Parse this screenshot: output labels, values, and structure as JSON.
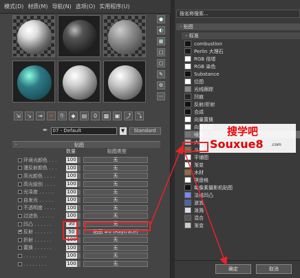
{
  "menu": [
    "模式(D)",
    "材质(M)",
    "导航(N)",
    "选项(O)",
    "实用程序(U)"
  ],
  "material_name": "07 - Default",
  "material_type": "Standard",
  "rollout_title": "贴图",
  "columns": {
    "amount": "数量",
    "map_type": "贴图类型"
  },
  "maps": [
    {
      "label": "环境光颜色 . . .",
      "amount": "100",
      "map": "无",
      "checked": false
    },
    {
      "label": "漫反射颜色 . . .",
      "amount": "100",
      "map": "无",
      "checked": false
    },
    {
      "label": "高光颜色 . . . .",
      "amount": "100",
      "map": "无",
      "checked": false
    },
    {
      "label": "高光级别 . . . .",
      "amount": "100",
      "map": "无",
      "checked": false
    },
    {
      "label": "光泽度 . . . . .",
      "amount": "100",
      "map": "无",
      "checked": false
    },
    {
      "label": "自发光 . . . . .",
      "amount": "100",
      "map": "无",
      "checked": false
    },
    {
      "label": "不透明度 . . . .",
      "amount": "100",
      "map": "无",
      "checked": false
    },
    {
      "label": "过滤色 . . . . .",
      "amount": "100",
      "map": "无",
      "checked": false
    },
    {
      "label": "凹凸 . . . . . .",
      "amount": "30",
      "map": "无",
      "checked": false
    },
    {
      "label": "反射 . . . . . .",
      "amount": "50",
      "map": "贴图 #0 (Raytrace)",
      "checked": true
    },
    {
      "label": "折射 . . . . . .",
      "amount": "100",
      "map": "无",
      "checked": false
    },
    {
      "label": "置换 . . . . . .",
      "amount": "100",
      "map": "无",
      "checked": false
    },
    {
      "label": ". . . . . . . .",
      "amount": "100",
      "map": "无",
      "checked": false
    },
    {
      "label": ". . . . . . . .",
      "amount": "100",
      "map": "无",
      "checked": false
    }
  ],
  "browser": {
    "search_placeholder": "按名称搜索...",
    "section": "- 贴图",
    "subsection": "- 标准",
    "items": [
      {
        "label": "combustion",
        "color": "#111111"
      },
      {
        "label": "Perlin 大理石",
        "color": "#1a1a1a"
      },
      {
        "label": "RGB 倍增",
        "color": "#ffffff"
      },
      {
        "label": "RGB 染色",
        "color": "#ffffff"
      },
      {
        "label": "Substance",
        "color": "#111111"
      },
      {
        "label": "位图",
        "color": "#ffffff"
      },
      {
        "label": "光线跟踪",
        "color": "#888888"
      },
      {
        "label": "凹痕",
        "color": "#222222"
      },
      {
        "label": "反射/折射",
        "color": "#111111"
      },
      {
        "label": "合成",
        "color": "#111111"
      },
      {
        "label": "向量置换",
        "color": "#ffffff"
      },
      {
        "label": "向量贴图",
        "color": "#ffffff"
      },
      {
        "label": "噪波",
        "color": "#777777"
      },
      {
        "label": "大理石",
        "color": "#bbbbbb"
      },
      {
        "label": "斗铺",
        "color": "#8a6a44"
      },
      {
        "label": "平铺图",
        "color": "#ffffff"
      },
      {
        "label": "渐变",
        "color": "#ffffff"
      },
      {
        "label": "木材",
        "color": "#9a6a3a"
      },
      {
        "label": "棋盘格",
        "color": "#ffffff"
      },
      {
        "label": "每像素摄影机贴图",
        "color": "#111111"
      },
      {
        "label": "法线凹凸",
        "color": "#7788ff"
      },
      {
        "label": "波浪",
        "color": "#4466aa"
      },
      {
        "label": "泼溅",
        "color": "#ddddee"
      },
      {
        "label": "混合",
        "color": "#555555"
      },
      {
        "label": "渐变",
        "color": "#cccccc"
      }
    ]
  },
  "watermark": {
    "line1": "搜学吧",
    "line2": "Souxue8",
    "line3": ".com"
  },
  "buttons": {
    "ok": "确定",
    "cancel": "取消"
  },
  "colors": {
    "annotation": "#e8232a"
  }
}
